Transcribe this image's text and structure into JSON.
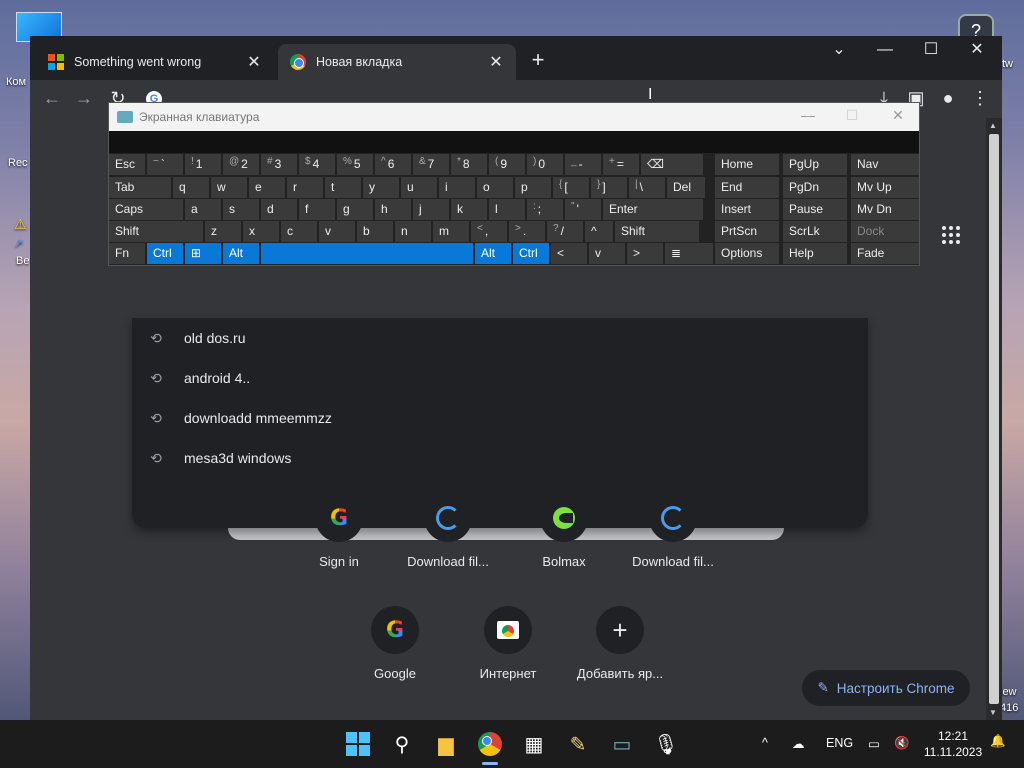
{
  "desktop": {
    "labels": [
      "Ком",
      "Rec",
      "Be"
    ],
    "right_labels": [
      "tw",
      "iew",
      "416"
    ]
  },
  "chrome": {
    "tabs": [
      {
        "title": "Something went wrong",
        "icon": "microsoft-icon"
      },
      {
        "title": "Новая вкладка",
        "icon": "chrome-icon"
      }
    ],
    "omnibox_icon": "G",
    "suggestions": [
      "old dos.ru",
      "android 4..",
      "downloadd mmeemmzz",
      "mesa3d windows"
    ],
    "shortcuts_row1": [
      {
        "label": "Sign in",
        "icon": "google-icon"
      },
      {
        "label": "Download fil...",
        "icon": "download-site-icon"
      },
      {
        "label": "Bolmax",
        "icon": "bolmax-icon"
      },
      {
        "label": "Download fil...",
        "icon": "download-site-icon"
      }
    ],
    "shortcuts_row2": [
      {
        "label": "Google",
        "icon": "google-icon"
      },
      {
        "label": "Интернет",
        "icon": "internet-icon"
      },
      {
        "label": "Добавить яр...",
        "icon": "plus-icon"
      }
    ],
    "customize_label": "Настроить Chrome"
  },
  "osk": {
    "title": "Экранная клавиатура",
    "row1": [
      {
        "sup": "~",
        "main": "`"
      },
      {
        "sup": "!",
        "main": "1"
      },
      {
        "sup": "@",
        "main": "2"
      },
      {
        "sup": "#",
        "main": "3"
      },
      {
        "sup": "$",
        "main": "4"
      },
      {
        "sup": "%",
        "main": "5"
      },
      {
        "sup": "^",
        "main": "6"
      },
      {
        "sup": "&",
        "main": "7"
      },
      {
        "sup": "*",
        "main": "8"
      },
      {
        "sup": "(",
        "main": "9"
      },
      {
        "sup": ")",
        "main": "0"
      },
      {
        "sup": "_",
        "main": "-"
      },
      {
        "sup": "+",
        "main": "="
      }
    ],
    "esc": "Esc",
    "bksp": "⌫",
    "tab": "Tab",
    "row2": [
      "q",
      "w",
      "e",
      "r",
      "t",
      "y",
      "u",
      "i",
      "o",
      "p"
    ],
    "row2_sym": [
      {
        "sup": "{",
        "main": "["
      },
      {
        "sup": "}",
        "main": "]"
      },
      {
        "sup": "|",
        "main": "\\"
      }
    ],
    "del": "Del",
    "caps": "Caps",
    "row3": [
      "a",
      "s",
      "d",
      "f",
      "g",
      "h",
      "j",
      "k",
      "l"
    ],
    "row3_sym": [
      {
        "sup": ":",
        "main": ";"
      },
      {
        "sup": "\"",
        "main": "'"
      }
    ],
    "enter": "Enter",
    "shift": "Shift",
    "row4": [
      "z",
      "x",
      "c",
      "v",
      "b",
      "n",
      "m"
    ],
    "row4_sym": [
      {
        "sup": "<",
        "main": ","
      },
      {
        "sup": ">",
        "main": "."
      },
      {
        "sup": "?",
        "main": "/"
      }
    ],
    "up": "^",
    "shift_r": "Shift",
    "fn": "Fn",
    "ctrl": "Ctrl",
    "alt": "Alt",
    "alt_r": "Alt",
    "ctrl_r": "Ctrl",
    "left": "<",
    "down": "v",
    "right": ">",
    "menu": "≣",
    "nav": [
      [
        "Home",
        "PgUp",
        "Nav"
      ],
      [
        "End",
        "PgDn",
        "Mv Up"
      ],
      [
        "Insert",
        "Pause",
        "Mv Dn"
      ],
      [
        "PrtScn",
        "ScrLk",
        "Dock"
      ],
      [
        "Options",
        "Help",
        "Fade"
      ]
    ]
  },
  "taskbar": {
    "lang": "ENG",
    "time": "12:21",
    "date": "11.11.2023"
  }
}
